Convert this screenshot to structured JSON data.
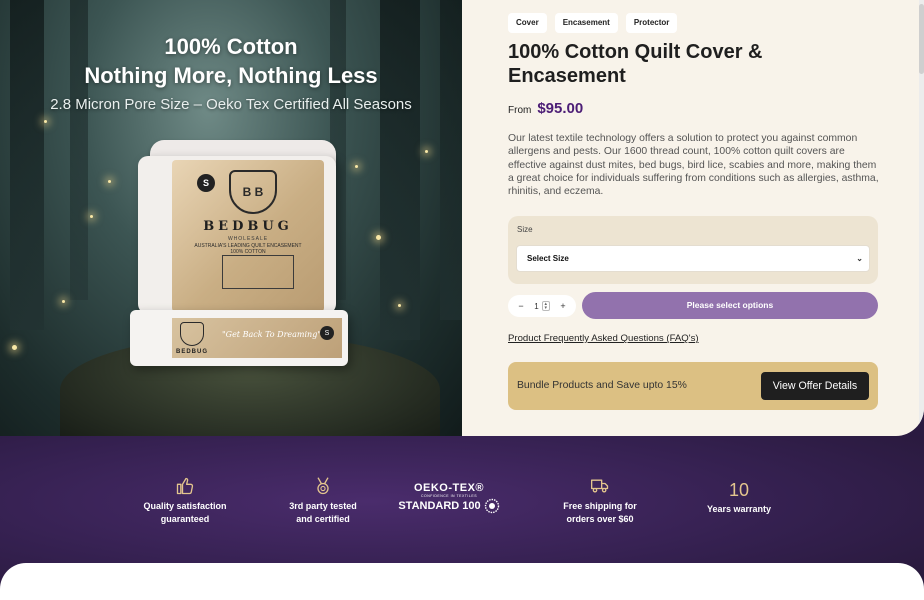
{
  "hero": {
    "headline_1": "100% Cotton",
    "headline_2": "Nothing More, Nothing Less",
    "subline": "2.8 Micron Pore Size – Oeko Tex Certified All Seasons",
    "package": {
      "size_badge": "S",
      "brand": "BEDBUG",
      "crest": "B B",
      "brand_small": "WHOLESALE",
      "tagline": "AUSTRALIA'S LEADING QUILT ENCASEMENT",
      "material": "100% COTTON",
      "slogan": "\"Get Back To Dreaming\""
    }
  },
  "product": {
    "tags": [
      "Cover",
      "Encasement",
      "Protector"
    ],
    "title": "100% Cotton Quilt Cover & Encasement",
    "price_prefix": "From",
    "price": "$95.00",
    "description": "Our latest textile technology offers a solution to protect you against common allergens and pests. Our 1600 thread count, 100% cotton quilt covers are effective against dust mites, bed bugs, bird lice, scabies and more, making them a great choice for individuals suffering from conditions such as allergies, asthma, rhinitis, and eczema.",
    "size_label": "Size",
    "size_select_value": "Select Size",
    "quantity": "1",
    "qty_minus": "−",
    "qty_plus": "+",
    "add_button": "Please select options",
    "faq_link": "Product Frequently Asked Questions (FAQ's)",
    "bundle_text": "Bundle Products and Save upto 15%",
    "offer_button": "View Offer Details"
  },
  "features": [
    {
      "icon": "thumbs-up-icon",
      "text_1": "Quality satisfaction",
      "text_2": "guaranteed"
    },
    {
      "icon": "medal-icon",
      "text_1": "3rd party tested",
      "text_2": "and certified"
    },
    {
      "icon": "oeko-tex-logo",
      "logo_line_1": "OEKO-TEX®",
      "logo_line_2": "CONFIDENCE IN TEXTILES",
      "logo_line_3": "STANDARD 100"
    },
    {
      "icon": "truck-icon",
      "text_1": "Free shipping for",
      "text_2": "orders over $60"
    },
    {
      "icon": "ten-years",
      "number": "10",
      "text_1": "Years warranty"
    }
  ],
  "colors": {
    "accent_purple": "#4c1d76",
    "button_purple": "#9272ad",
    "band_purple": "#34204f",
    "bundle_gold": "#dcc083",
    "page_cream": "#f8f3ea"
  }
}
